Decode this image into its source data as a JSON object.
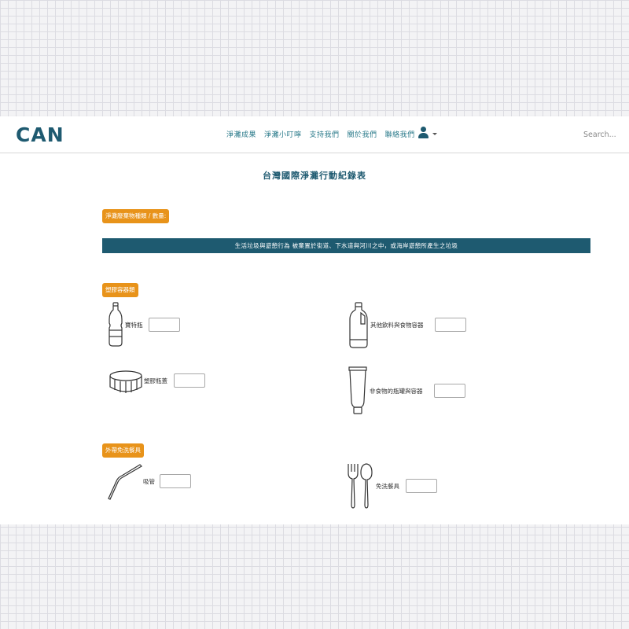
{
  "brand": {
    "logo_text": "CAN"
  },
  "nav": {
    "links": [
      "淨灘成果",
      "淨灘小叮嚀",
      "支持我們",
      "關於我們",
      "聯絡我們"
    ]
  },
  "search": {
    "placeholder": "Search..."
  },
  "page": {
    "title": "台灣國際淨灘行動紀錄表"
  },
  "section_header": "淨灘廢棄物種類 / 數量:",
  "banner": "生活垃圾與遊憩行為 被棄置於街道、下水道與河川之中，或海岸遊憩所產生之垃圾",
  "categories": {
    "plastic_containers": {
      "title": "塑膠容器類",
      "items": {
        "pet_bottle": "寶特瓶",
        "other_beverage": "其他飲料與食物容器",
        "plastic_cap": "塑膠瓶蓋",
        "non_food": "非食物的瓶罐與容器"
      }
    },
    "takeout": {
      "title": "外帶免洗餐具",
      "items": {
        "straw": "吸管",
        "disposable_utensils": "免洗餐具"
      }
    }
  },
  "colors": {
    "brand_teal": "#1e5a70",
    "accent_orange": "#e8931a",
    "nav_link": "#2a7a8a"
  },
  "icons": [
    "user-icon",
    "caret-down-icon",
    "plastic-bottle-icon",
    "jug-icon",
    "bottle-cap-icon",
    "tube-icon",
    "straw-icon",
    "fork-spoon-icon"
  ]
}
